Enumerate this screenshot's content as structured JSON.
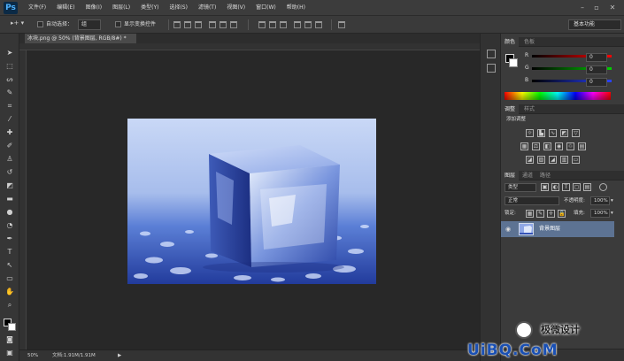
{
  "app": {
    "logo": "Ps"
  },
  "menu": [
    "文件(F)",
    "编辑(E)",
    "图像(I)",
    "图层(L)",
    "类型(Y)",
    "选择(S)",
    "滤镜(T)",
    "视图(V)",
    "窗口(W)",
    "帮助(H)"
  ],
  "options": {
    "auto_select_label": "自动选择：",
    "auto_select_value": "组",
    "show_transform_label": "显示变换控件",
    "workspace": "基本功能"
  },
  "document": {
    "tab_label": "冰块.png @ 50% (背景图层, RGB/8#) *",
    "zoom": "50%",
    "doc_info": "文档:1.91M/1.91M"
  },
  "color_panel": {
    "tabs": [
      "颜色",
      "色板"
    ],
    "channels": [
      {
        "label": "R",
        "value": "0",
        "color": "#d42020"
      },
      {
        "label": "G",
        "value": "0",
        "color": "#1fb31f"
      },
      {
        "label": "B",
        "value": "0",
        "color": "#2a43d6"
      }
    ]
  },
  "adjust_panel": {
    "tabs": [
      "调整",
      "样式"
    ],
    "title": "添加调整"
  },
  "layers_panel": {
    "tabs": [
      "图层",
      "通道",
      "路径"
    ],
    "filter_kind": "类型",
    "blend_mode": "正常",
    "opacity_label": "不透明度:",
    "opacity_value": "100%",
    "lock_label": "锁定:",
    "fill_label": "填充:",
    "fill_value": "100%",
    "layers": [
      {
        "name": "背景图层"
      }
    ]
  },
  "watermark": {
    "text": "极微设计",
    "brand": "UiBQ.CoM"
  }
}
